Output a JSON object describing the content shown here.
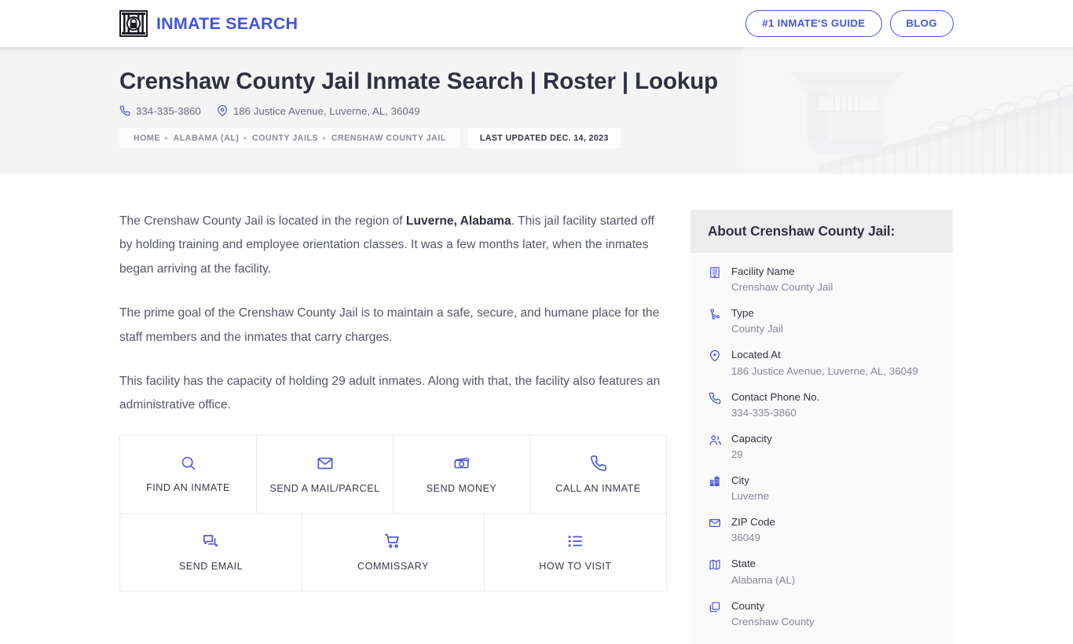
{
  "brand": {
    "name": "INMATE SEARCH",
    "logo_icon": "jail-padlock-icon"
  },
  "nav": {
    "buttons": [
      {
        "label": "#1 INMATE'S GUIDE",
        "name": "inmates-guide-button"
      },
      {
        "label": "BLOG",
        "name": "blog-button"
      }
    ]
  },
  "hero": {
    "title": "Crenshaw County Jail Inmate Search | Roster | Lookup",
    "phone": "334-335-3860",
    "address": "186 Justice Avenue, Luverne, AL, 36049",
    "phone_icon": "phone-icon",
    "location_icon": "map-pin-icon",
    "background_image": "prison-watchtower-fence-photo"
  },
  "breadcrumb": {
    "items": [
      {
        "label": "HOME"
      },
      {
        "label": "ALABAMA (AL)"
      },
      {
        "label": "COUNTY JAILS"
      },
      {
        "label": "CRENSHAW COUNTY JAIL"
      }
    ],
    "separator": "▸",
    "last_updated": "LAST UPDATED DEC. 14, 2023"
  },
  "main": {
    "paragraphs": [
      {
        "pre": "The Crenshaw County Jail is located in the region of ",
        "bold": "Luverne, Alabama",
        "post": ". This jail facility started off by holding training and employee orientation classes. It was a few months later, when the inmates began arriving at the facility."
      },
      {
        "pre": "The prime goal of the Crenshaw County Jail is to maintain a safe, secure, and humane place for the staff members and the inmates that carry charges.",
        "bold": "",
        "post": ""
      },
      {
        "pre": "This facility has the capacity of holding 29 adult inmates. Along with that, the facility also features an administrative office.",
        "bold": "",
        "post": ""
      }
    ],
    "actions_row1": [
      {
        "label": "FIND AN INMATE",
        "icon": "search-icon",
        "name": "find-an-inmate-action"
      },
      {
        "label": "SEND A MAIL/PARCEL",
        "icon": "envelope-icon",
        "name": "send-mail-parcel-action"
      },
      {
        "label": "SEND MONEY",
        "icon": "money-icon",
        "name": "send-money-action"
      },
      {
        "label": "CALL AN INMATE",
        "icon": "phone-icon",
        "name": "call-an-inmate-action"
      }
    ],
    "actions_row2": [
      {
        "label": "SEND EMAIL",
        "icon": "chat-bubble-icon",
        "name": "send-email-action"
      },
      {
        "label": "COMMISSARY",
        "icon": "shopping-cart-icon",
        "name": "commissary-action"
      },
      {
        "label": "HOW TO VISIT",
        "icon": "list-icon",
        "name": "how-to-visit-action"
      }
    ]
  },
  "sidebar": {
    "title": "About Crenshaw County Jail:",
    "fields": [
      {
        "label": "Facility Name",
        "value": "Crenshaw County Jail",
        "icon": "building-icon"
      },
      {
        "label": "Type",
        "value": "County Jail",
        "icon": "node-branch-icon"
      },
      {
        "label": "Located At",
        "value": "186 Justice Avenue, Luverne, AL, 36049",
        "icon": "map-pin-icon"
      },
      {
        "label": "Contact Phone No.",
        "value": "334-335-3860",
        "icon": "phone-icon"
      },
      {
        "label": "Capacity",
        "value": "29",
        "icon": "people-icon"
      },
      {
        "label": "City",
        "value": "Luverne",
        "icon": "city-icon"
      },
      {
        "label": "ZIP Code",
        "value": "36049",
        "icon": "envelope-icon"
      },
      {
        "label": "State",
        "value": "Alabama (AL)",
        "icon": "map-icon"
      },
      {
        "label": "County",
        "value": "Crenshaw County",
        "icon": "copy-icon"
      }
    ]
  },
  "colors": {
    "brand_blue": "#4355db",
    "icon_blue": "#4a56d8",
    "hero_bg": "#f4f4f5",
    "card_head_bg": "#ededee",
    "card_bg": "#fafafa",
    "border": "#e9e9ec",
    "text_dark": "#32333f",
    "text_muted": "#85879a"
  }
}
